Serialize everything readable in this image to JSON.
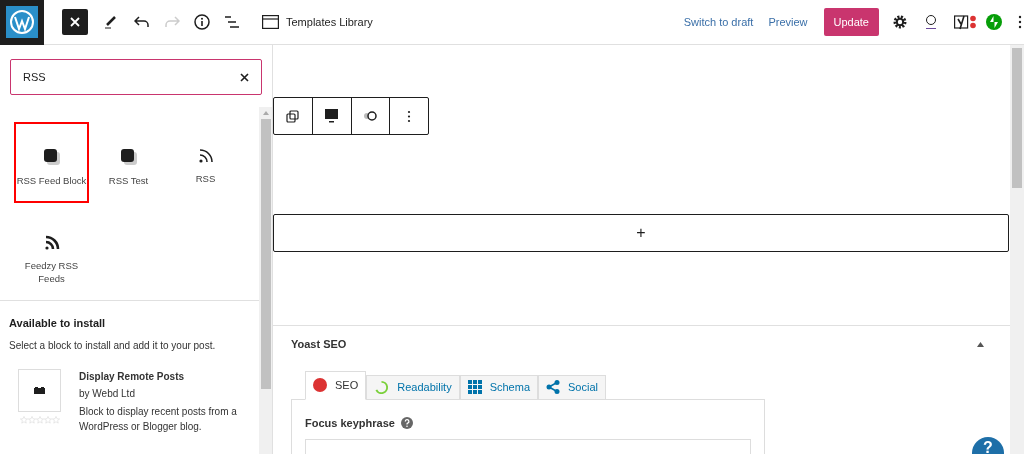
{
  "header": {
    "title": "Templates Library",
    "switch_to_draft": "Switch to draft",
    "preview": "Preview",
    "update": "Update"
  },
  "search": {
    "value": "RSS"
  },
  "blocks": [
    {
      "label": "RSS Feed Block",
      "kind": "square",
      "selected": true
    },
    {
      "label": "RSS Test",
      "kind": "square",
      "selected": false
    },
    {
      "label": "RSS",
      "kind": "rss",
      "selected": false
    },
    {
      "label": "Feedzy RSS Feeds",
      "kind": "rss-bold",
      "selected": false
    }
  ],
  "install": {
    "heading": "Available to install",
    "description": "Select a block to install and add it to your post.",
    "items": [
      {
        "title": "Display Remote Posts",
        "author": "by Webd Ltd",
        "stars": 0,
        "description": "Block to display recent posts from a WordPress or Blogger blog."
      }
    ]
  },
  "add_block": "+",
  "yoast": {
    "title": "Yoast SEO",
    "tabs": [
      {
        "label": "SEO",
        "kind": "dot",
        "selected": true
      },
      {
        "label": "Readability",
        "kind": "ring",
        "selected": false
      },
      {
        "label": "Schema",
        "kind": "grid",
        "selected": false
      },
      {
        "label": "Social",
        "kind": "share",
        "selected": false
      }
    ],
    "focus_label": "Focus keyphrase"
  },
  "help": "?"
}
